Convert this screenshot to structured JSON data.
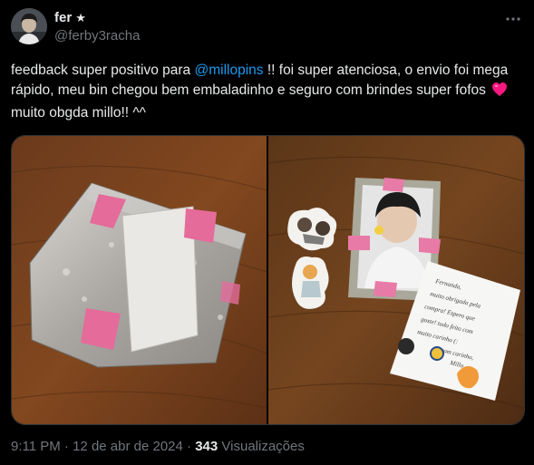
{
  "author": {
    "name": "fer",
    "badge": "★",
    "handle": "@ferby3racha"
  },
  "tweet": {
    "text_before": "feedback super positivo para ",
    "mention": "@millopins",
    "text_after": " !! foi super atenciosa, o envio foi mega rápido, meu bin chegou bem embaladinho e seguro com brindes super fofos ",
    "text_end": " muito obgda millo!! ^^"
  },
  "media": {
    "left_photo": "package-photo",
    "right_photo": "photocard-photo",
    "note_lines": [
      "Fernanda,",
      "muito obrigada pela",
      "compra! Espero que",
      "goste! tudo feito com",
      "muito carinho (:",
      "com carinho,",
      "Millo"
    ]
  },
  "meta": {
    "time": "9:11 PM",
    "separator": "·",
    "date": "12 de abr de 2024",
    "views_count": "343",
    "views_label": "Visualizações"
  },
  "colors": {
    "background": "#000000",
    "text": "#e7e9ea",
    "secondary": "#71767b",
    "link": "#1d9bf0",
    "heart": "#f91880"
  }
}
